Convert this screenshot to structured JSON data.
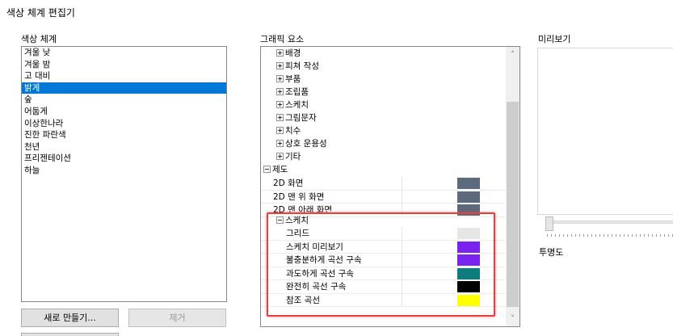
{
  "dialog": {
    "title": "색상 체계 편집기"
  },
  "labels": {
    "scheme": "색상 체계",
    "graphic_elements": "그래픽 요소",
    "preview": "미리보기",
    "transparency": "투명도"
  },
  "schemes": [
    {
      "label": "겨울 낮",
      "selected": false
    },
    {
      "label": "겨울 밤",
      "selected": false
    },
    {
      "label": "고 대비",
      "selected": false
    },
    {
      "label": "밝게",
      "selected": true
    },
    {
      "label": "숲",
      "selected": false
    },
    {
      "label": "어둡게",
      "selected": false
    },
    {
      "label": "이상한나라",
      "selected": false
    },
    {
      "label": "진한 파란색",
      "selected": false
    },
    {
      "label": "천년",
      "selected": false
    },
    {
      "label": "프리젠테이션",
      "selected": false
    },
    {
      "label": "하늘",
      "selected": false
    }
  ],
  "buttons": {
    "new": "새로 만들기...",
    "remove": "제거"
  },
  "tree": {
    "collapsed_groups": [
      "배경",
      "피쳐 작성",
      "부품",
      "조립품",
      "스케치",
      "그림문자",
      "치수",
      "상호 운용성",
      "기타"
    ],
    "drawing": {
      "label": "제도",
      "items": [
        {
          "label": "2D 화면",
          "color": "#5b6a7c"
        },
        {
          "label": "2D 맨 위 화면",
          "color": "#5b6a7c"
        },
        {
          "label": "2D 맨 아래 화면",
          "color": "#5b6a7c"
        }
      ],
      "sketch": {
        "label": "스케치",
        "items": [
          {
            "label": "그리드",
            "color": "#e6e6e6"
          },
          {
            "label": "스케치 미리보기",
            "color": "#7a22ee"
          },
          {
            "label": "불충분하게 곡선 구속",
            "color": "#7a22ee"
          },
          {
            "label": "과도하게 곡선 구속",
            "color": "#0e7b7f"
          },
          {
            "label": "완전히 곡선 구속",
            "color": "#000000"
          },
          {
            "label": "참조 곡선",
            "color": "#ffff00"
          }
        ]
      }
    }
  },
  "icons": {
    "expand": "plus-box-icon",
    "collapse": "minus-box-icon",
    "scroll_up": "chevron-up-icon",
    "scroll_down": "chevron-down-icon"
  }
}
